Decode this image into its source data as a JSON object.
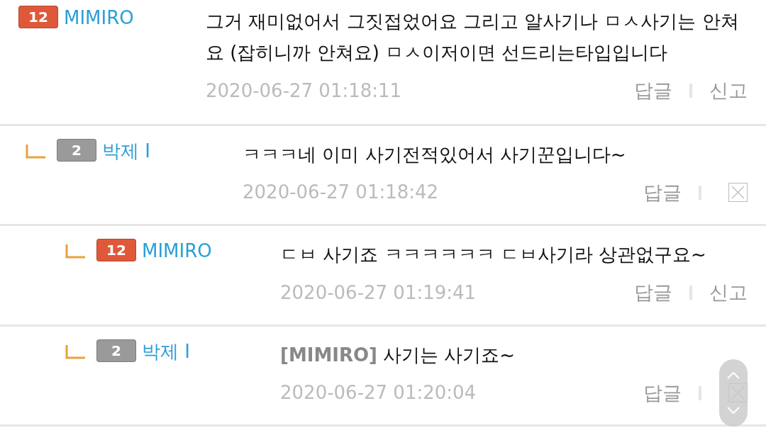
{
  "comments": [
    {
      "level": "12",
      "color": "#e0583a",
      "author": "MIMIRO",
      "text": "그거 재미없어서 그짓접었어요 그리고 알사기나 ㅁㅅ사기는 안쳐요 (잡히니까 안쳐요) ㅁㅅ이저이면 선드리는타입입니다",
      "date": "2020-06-27 01:18:11",
      "actions": [
        {
          "kind": "text",
          "label": "답글"
        },
        {
          "kind": "text",
          "label": "신고"
        }
      ],
      "children": [
        {
          "level": "2",
          "color": "#9a9a9a",
          "author": "박제 I",
          "text": "ㅋㅋㅋ네 이미 사기전적있어서 사기꾼입니다~",
          "date": "2020-06-27 01:18:42",
          "actions": [
            {
              "kind": "text",
              "label": "답글"
            },
            {
              "kind": "delete"
            }
          ],
          "children": [
            {
              "level": "12",
              "color": "#e0583a",
              "author": "MIMIRO",
              "text": "ㄷㅂ 사기죠 ㅋㅋㅋㅋㅋㅋ ㄷㅂ사기라 상관없구요~",
              "date": "2020-06-27 01:19:41",
              "actions": [
                {
                  "kind": "text",
                  "label": "답글"
                },
                {
                  "kind": "text",
                  "label": "신고"
                }
              ]
            },
            {
              "level": "2",
              "color": "#9a9a9a",
              "author": "박제 I",
              "mention": "[MIMIRO]",
              "text": "사기는 사기죠~",
              "date": "2020-06-27 01:20:04",
              "actions": [
                {
                  "kind": "text",
                  "label": "답글"
                },
                {
                  "kind": "delete"
                }
              ]
            }
          ]
        }
      ]
    }
  ]
}
